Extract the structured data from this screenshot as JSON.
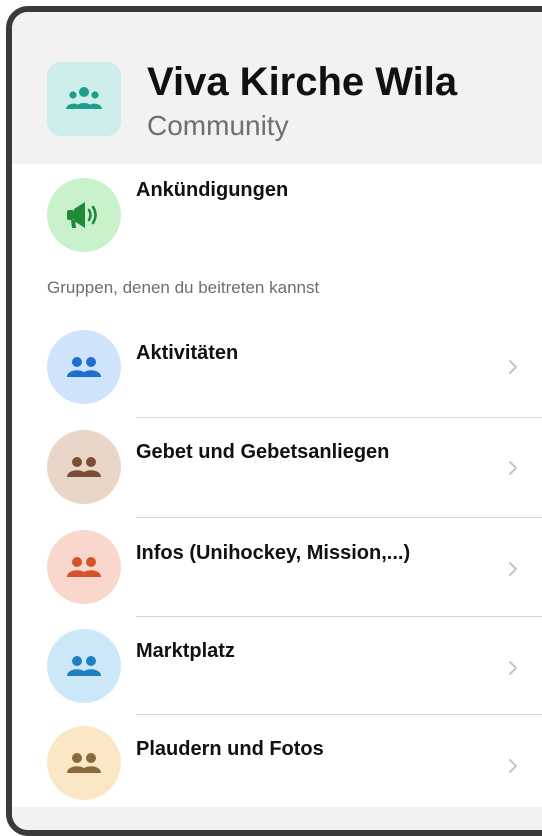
{
  "header": {
    "title": "Viva Kirche Wila",
    "subtitle": "Community",
    "icon": "group-icon",
    "icon_bg": "#cdeeea",
    "icon_color": "#1f9e8e"
  },
  "announcements": {
    "label": "Ankündigungen",
    "icon": "megaphone-icon",
    "avatar_bg": "#c9f2cc",
    "icon_color": "#1e8a3a"
  },
  "section_label": "Gruppen, denen du beitreten kannst",
  "groups": [
    {
      "label": "Aktivitäten",
      "icon": "group-icon",
      "avatar_bg": "#cfe3fb",
      "icon_color": "#1f6fd1"
    },
    {
      "label": "Gebet und Gebetsanliegen",
      "icon": "group-icon",
      "avatar_bg": "#ead6c9",
      "icon_color": "#7a4e36"
    },
    {
      "label": "Infos (Unihockey, Mission,...)",
      "icon": "group-icon",
      "avatar_bg": "#f9d7cc",
      "icon_color": "#d4532b"
    },
    {
      "label": "Marktplatz",
      "icon": "group-icon",
      "avatar_bg": "#cce8f8",
      "icon_color": "#1f7fbf"
    },
    {
      "label": "Plaudern und Fotos",
      "icon": "group-icon",
      "avatar_bg": "#fbe7c6",
      "icon_color": "#8a6a3a"
    }
  ],
  "chevron_icon": "chevron-right-icon"
}
